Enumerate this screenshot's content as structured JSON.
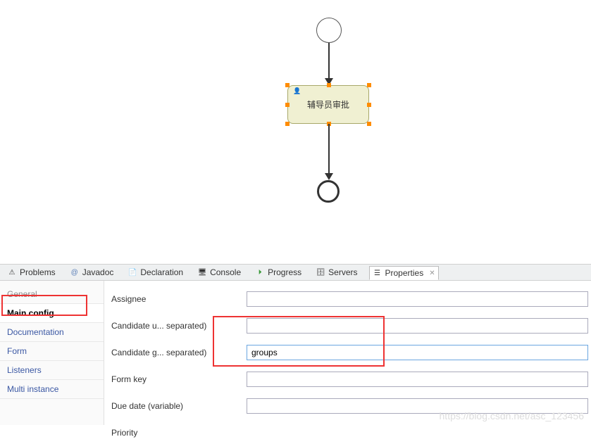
{
  "canvas": {
    "task_label": "辅导员审批"
  },
  "tabs": {
    "problems": "Problems",
    "javadoc": "Javadoc",
    "declaration": "Declaration",
    "console": "Console",
    "progress": "Progress",
    "servers": "Servers",
    "properties": "Properties"
  },
  "sideTabs": {
    "general": "General",
    "main_config": "Main config",
    "documentation": "Documentation",
    "form": "Form",
    "listeners": "Listeners",
    "multi_instance": "Multi instance"
  },
  "form": {
    "assignee": {
      "label": "Assignee",
      "value": ""
    },
    "candidate_users": {
      "label": "Candidate u... separated)",
      "value": ""
    },
    "candidate_groups": {
      "label": "Candidate g... separated)",
      "value": "groups"
    },
    "form_key": {
      "label": "Form key",
      "value": ""
    },
    "due_date": {
      "label": "Due date (variable)",
      "value": ""
    },
    "priority": {
      "label": "Priority",
      "value": ""
    }
  },
  "watermark": "https://blog.csdn.net/asc_123456"
}
